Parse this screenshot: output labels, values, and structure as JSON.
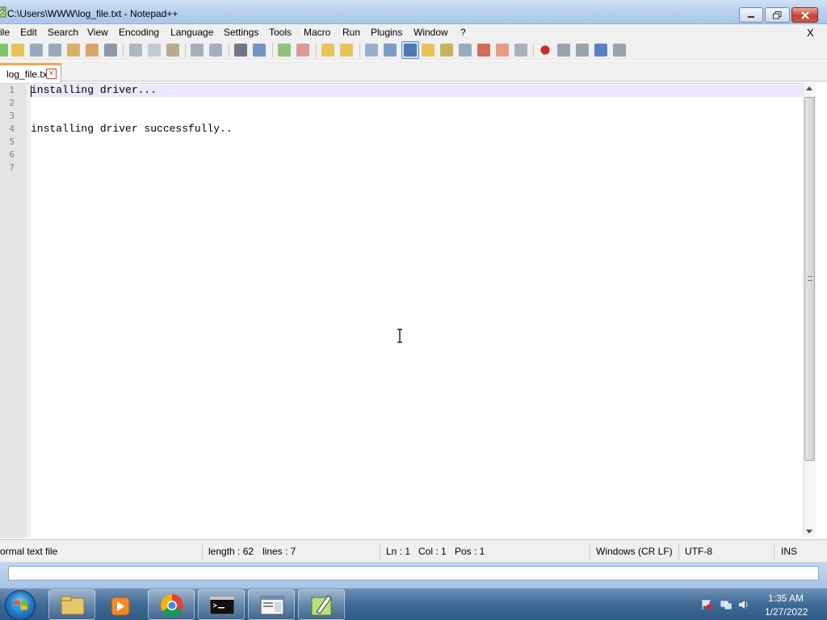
{
  "window": {
    "title": "C:\\Users\\WWW\\log_file.txt - Notepad++"
  },
  "menu": {
    "items": [
      "ile",
      "Edit",
      "Search",
      "View",
      "Encoding",
      "Language",
      "Settings",
      "Tools",
      "Macro",
      "Run",
      "Plugins",
      "Window",
      "?"
    ],
    "close_label": "X"
  },
  "tabs": [
    {
      "label": "log_file.txt",
      "close": "×"
    }
  ],
  "editor": {
    "line_numbers": [
      "1",
      "2",
      "3",
      "4",
      "5",
      "6",
      "7"
    ],
    "lines": [
      "installing driver...",
      "",
      "",
      "installing driver successfully..",
      "",
      "",
      ""
    ]
  },
  "statusbar": {
    "filetype": "ormal text file",
    "length": "length : 62",
    "lines": "lines : 7",
    "ln": "Ln : 1",
    "col": "Col : 1",
    "pos": "Pos : 1",
    "eol": "Windows (CR LF)",
    "encoding": "UTF-8",
    "mode": "INS"
  },
  "taskbar": {
    "apps": [
      "explorer-icon",
      "media-player-icon",
      "chrome-icon",
      "cmd-icon",
      "window-app-icon",
      "notepadpp-icon"
    ],
    "clock_time": "1:35 AM",
    "clock_date": "1/27/2022"
  },
  "colors": {
    "current_line": "#e8e8ff",
    "tab_accent": "#f6a54c",
    "taskbar": "#3f6a96"
  }
}
